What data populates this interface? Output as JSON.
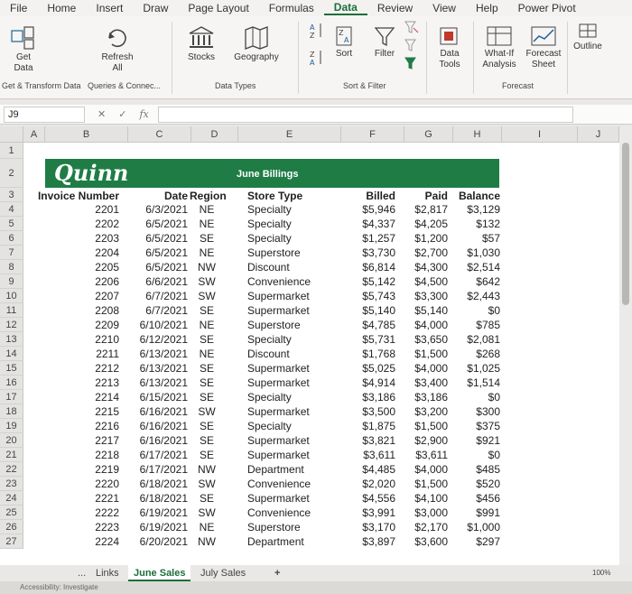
{
  "menu": [
    "File",
    "Home",
    "Insert",
    "Draw",
    "Page Layout",
    "Formulas",
    "Data",
    "Review",
    "View",
    "Help",
    "Power Pivot"
  ],
  "active_menu": "Data",
  "ribbon": {
    "get_data": "Get Data",
    "refresh_all": "Refresh All",
    "stocks": "Stocks",
    "geography": "Geography",
    "sort": "Sort",
    "filter": "Filter",
    "data_tools": "Data Tools",
    "what_if": "What-If Analysis",
    "forecast_sheet": "Forecast Sheet",
    "outline": "Outline",
    "groups": {
      "get_transform": "Get & Transform Data",
      "queries": "Queries & Connec...",
      "data_types": "Data Types",
      "sort_filter": "Sort & Filter",
      "forecast": "Forecast"
    }
  },
  "formula_bar": {
    "name_box": "J9",
    "fx": "fx"
  },
  "columns": [
    "A",
    "B",
    "C",
    "D",
    "E",
    "F",
    "G",
    "H",
    "I",
    "J"
  ],
  "banner": {
    "logo": "Quinn",
    "title": "June Billings"
  },
  "table": {
    "headers": [
      "Invoice Number",
      "Date",
      "Region",
      "Store Type",
      "Billed",
      "Paid",
      "Balance"
    ],
    "rows": [
      [
        "2201",
        "6/3/2021",
        "NE",
        "Specialty",
        "$5,946",
        "$2,817",
        "$3,129"
      ],
      [
        "2202",
        "6/5/2021",
        "NE",
        "Specialty",
        "$4,337",
        "$4,205",
        "$132"
      ],
      [
        "2203",
        "6/5/2021",
        "SE",
        "Specialty",
        "$1,257",
        "$1,200",
        "$57"
      ],
      [
        "2204",
        "6/5/2021",
        "NE",
        "Superstore",
        "$3,730",
        "$2,700",
        "$1,030"
      ],
      [
        "2205",
        "6/5/2021",
        "NW",
        "Discount",
        "$6,814",
        "$4,300",
        "$2,514"
      ],
      [
        "2206",
        "6/6/2021",
        "SW",
        "Convenience",
        "$5,142",
        "$4,500",
        "$642"
      ],
      [
        "2207",
        "6/7/2021",
        "SW",
        "Supermarket",
        "$5,743",
        "$3,300",
        "$2,443"
      ],
      [
        "2208",
        "6/7/2021",
        "SE",
        "Supermarket",
        "$5,140",
        "$5,140",
        "$0"
      ],
      [
        "2209",
        "6/10/2021",
        "NE",
        "Superstore",
        "$4,785",
        "$4,000",
        "$785"
      ],
      [
        "2210",
        "6/12/2021",
        "SE",
        "Specialty",
        "$5,731",
        "$3,650",
        "$2,081"
      ],
      [
        "2211",
        "6/13/2021",
        "NE",
        "Discount",
        "$1,768",
        "$1,500",
        "$268"
      ],
      [
        "2212",
        "6/13/2021",
        "SE",
        "Supermarket",
        "$5,025",
        "$4,000",
        "$1,025"
      ],
      [
        "2213",
        "6/13/2021",
        "SE",
        "Supermarket",
        "$4,914",
        "$3,400",
        "$1,514"
      ],
      [
        "2214",
        "6/15/2021",
        "SE",
        "Specialty",
        "$3,186",
        "$3,186",
        "$0"
      ],
      [
        "2215",
        "6/16/2021",
        "SW",
        "Supermarket",
        "$3,500",
        "$3,200",
        "$300"
      ],
      [
        "2216",
        "6/16/2021",
        "SE",
        "Specialty",
        "$1,875",
        "$1,500",
        "$375"
      ],
      [
        "2217",
        "6/16/2021",
        "SE",
        "Supermarket",
        "$3,821",
        "$2,900",
        "$921"
      ],
      [
        "2218",
        "6/17/2021",
        "SE",
        "Supermarket",
        "$3,611",
        "$3,611",
        "$0"
      ],
      [
        "2219",
        "6/17/2021",
        "NW",
        "Department",
        "$4,485",
        "$4,000",
        "$485"
      ],
      [
        "2220",
        "6/18/2021",
        "SW",
        "Convenience",
        "$2,020",
        "$1,500",
        "$520"
      ],
      [
        "2221",
        "6/18/2021",
        "SE",
        "Supermarket",
        "$4,556",
        "$4,100",
        "$456"
      ],
      [
        "2222",
        "6/19/2021",
        "SW",
        "Convenience",
        "$3,991",
        "$3,000",
        "$991"
      ],
      [
        "2223",
        "6/19/2021",
        "NE",
        "Superstore",
        "$3,170",
        "$2,170",
        "$1,000"
      ],
      [
        "2224",
        "6/20/2021",
        "NW",
        "Department",
        "$3,897",
        "$3,600",
        "$297"
      ]
    ]
  },
  "sheet_tabs": [
    "Links",
    "June Sales",
    "July Sales"
  ],
  "active_tab": "June Sales",
  "add_sheet": "+",
  "ellipsis": "...",
  "zoom": "100%",
  "status": "Accessibility: Investigate"
}
